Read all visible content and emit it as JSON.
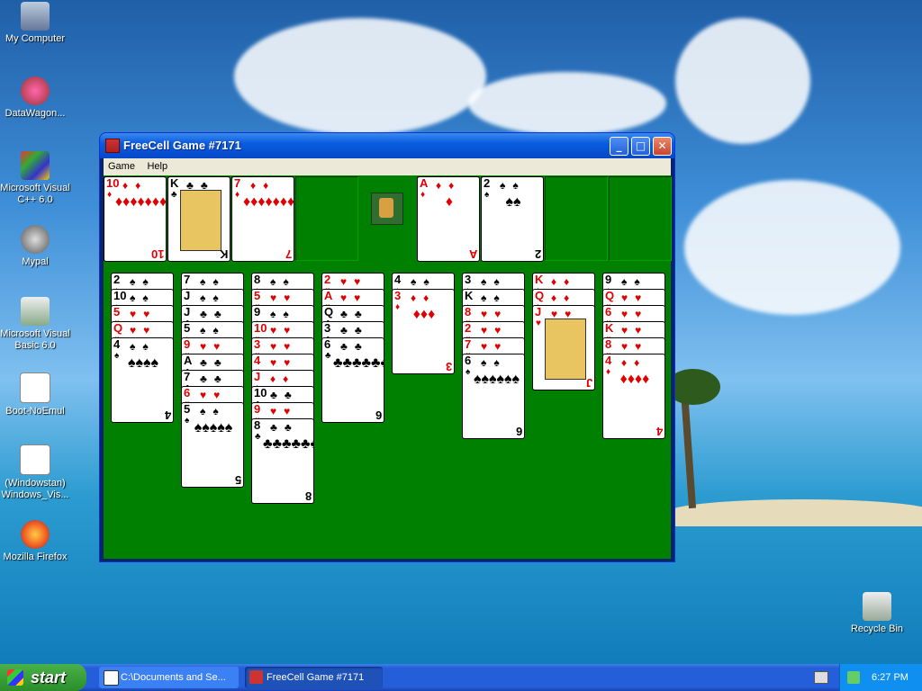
{
  "desktop": {
    "icons": [
      {
        "label": "My Computer"
      },
      {
        "label": "DataWagon..."
      },
      {
        "label": "Microsoft Visual C++ 6.0"
      },
      {
        "label": "Mypal"
      },
      {
        "label": "Microsoft Visual Basic 6.0"
      },
      {
        "label": "Boot-NoEmul"
      },
      {
        "label": "(Windowstan) Windows_Vis..."
      },
      {
        "label": "Mozilla Firefox"
      },
      {
        "label": "Recycle Bin"
      }
    ]
  },
  "window": {
    "title": "FreeCell Game #7171",
    "min_label": "_",
    "max_label": "□",
    "close_label": "✕",
    "menu": [
      "Game",
      "Help"
    ]
  },
  "game": {
    "free_cells": [
      {
        "rank": "10",
        "suit": "♦",
        "color": "red"
      },
      {
        "rank": "K",
        "suit": "♣",
        "color": "black"
      },
      {
        "rank": "7",
        "suit": "♦",
        "color": "red"
      },
      null
    ],
    "foundations": [
      {
        "rank": "A",
        "suit": "♦",
        "color": "red"
      },
      {
        "rank": "2",
        "suit": "♠",
        "color": "black"
      },
      null,
      null
    ],
    "columns": [
      [
        {
          "rank": "2",
          "suit": "♠",
          "color": "black"
        },
        {
          "rank": "10",
          "suit": "♠",
          "color": "black"
        },
        {
          "rank": "5",
          "suit": "♥",
          "color": "red"
        },
        {
          "rank": "Q",
          "suit": "♥",
          "color": "red"
        },
        {
          "rank": "4",
          "suit": "♠",
          "color": "black"
        }
      ],
      [
        {
          "rank": "7",
          "suit": "♠",
          "color": "black"
        },
        {
          "rank": "J",
          "suit": "♠",
          "color": "black"
        },
        {
          "rank": "J",
          "suit": "♣",
          "color": "black"
        },
        {
          "rank": "5",
          "suit": "♠",
          "color": "black"
        },
        {
          "rank": "9",
          "suit": "♥",
          "color": "red"
        },
        {
          "rank": "A",
          "suit": "♣",
          "color": "black"
        },
        {
          "rank": "7",
          "suit": "♣",
          "color": "black"
        },
        {
          "rank": "6",
          "suit": "♥",
          "color": "red"
        },
        {
          "rank": "5",
          "suit": "♠",
          "color": "black"
        }
      ],
      [
        {
          "rank": "8",
          "suit": "♠",
          "color": "black"
        },
        {
          "rank": "5",
          "suit": "♥",
          "color": "red"
        },
        {
          "rank": "9",
          "suit": "♠",
          "color": "black"
        },
        {
          "rank": "10",
          "suit": "♥",
          "color": "red"
        },
        {
          "rank": "3",
          "suit": "♥",
          "color": "red"
        },
        {
          "rank": "4",
          "suit": "♥",
          "color": "red"
        },
        {
          "rank": "J",
          "suit": "♦",
          "color": "red"
        },
        {
          "rank": "10",
          "suit": "♣",
          "color": "black"
        },
        {
          "rank": "9",
          "suit": "♥",
          "color": "red"
        },
        {
          "rank": "8",
          "suit": "♣",
          "color": "black"
        }
      ],
      [
        {
          "rank": "2",
          "suit": "♥",
          "color": "red"
        },
        {
          "rank": "A",
          "suit": "♥",
          "color": "red"
        },
        {
          "rank": "Q",
          "suit": "♣",
          "color": "black"
        },
        {
          "rank": "3",
          "suit": "♣",
          "color": "black"
        },
        {
          "rank": "6",
          "suit": "♣",
          "color": "black"
        }
      ],
      [
        {
          "rank": "4",
          "suit": "♠",
          "color": "black"
        },
        {
          "rank": "3",
          "suit": "♦",
          "color": "red"
        }
      ],
      [
        {
          "rank": "3",
          "suit": "♠",
          "color": "black"
        },
        {
          "rank": "K",
          "suit": "♠",
          "color": "black"
        },
        {
          "rank": "8",
          "suit": "♥",
          "color": "red"
        },
        {
          "rank": "2",
          "suit": "♥",
          "color": "red"
        },
        {
          "rank": "7",
          "suit": "♥",
          "color": "red"
        },
        {
          "rank": "6",
          "suit": "♠",
          "color": "black"
        }
      ],
      [
        {
          "rank": "K",
          "suit": "♦",
          "color": "red"
        },
        {
          "rank": "Q",
          "suit": "♦",
          "color": "red"
        },
        {
          "rank": "J",
          "suit": "♥",
          "color": "red"
        }
      ],
      [
        {
          "rank": "9",
          "suit": "♠",
          "color": "black"
        },
        {
          "rank": "Q",
          "suit": "♥",
          "color": "red"
        },
        {
          "rank": "6",
          "suit": "♥",
          "color": "red"
        },
        {
          "rank": "K",
          "suit": "♥",
          "color": "red"
        },
        {
          "rank": "8",
          "suit": "♥",
          "color": "red"
        },
        {
          "rank": "4",
          "suit": "♦",
          "color": "red"
        }
      ]
    ]
  },
  "taskbar": {
    "start_label": "start",
    "tasks": [
      {
        "label": "C:\\Documents and Se..."
      },
      {
        "label": "FreeCell Game #7171"
      }
    ],
    "clock": "6:27 PM"
  },
  "colors": {
    "felt": "#008000",
    "title_blue": "#0a5ce0",
    "taskbar_blue": "#245ed8",
    "start_green": "#3a9f3a"
  }
}
